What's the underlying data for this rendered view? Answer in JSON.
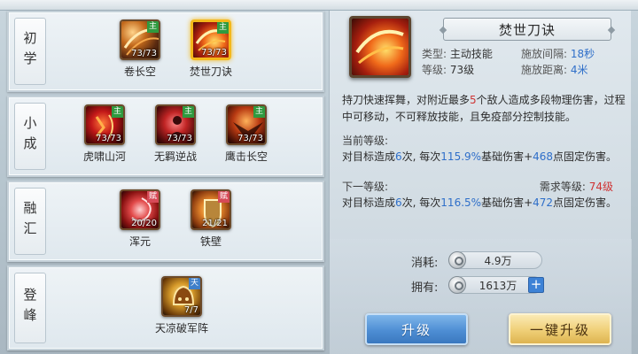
{
  "tiers": [
    {
      "label": "初学",
      "skills": [
        {
          "name": "卷长空",
          "count": "73/73",
          "badge": "主",
          "badge_type": "main",
          "icon": "wind-slash-icon",
          "selected": false
        },
        {
          "name": "焚世刀诀",
          "count": "73/73",
          "badge": "主",
          "badge_type": "main",
          "icon": "flame-blade-icon",
          "selected": true
        }
      ]
    },
    {
      "label": "小成",
      "skills": [
        {
          "name": "虎啸山河",
          "count": "73/73",
          "badge": "主",
          "badge_type": "main",
          "icon": "tiger-roar-icon"
        },
        {
          "name": "无羁逆战",
          "count": "73/73",
          "badge": "主",
          "badge_type": "main",
          "icon": "warrior-stance-icon"
        },
        {
          "name": "鹰击长空",
          "count": "73/73",
          "badge": "主",
          "badge_type": "main",
          "icon": "eagle-strike-icon"
        }
      ]
    },
    {
      "label": "融汇",
      "skills": [
        {
          "name": "浑元",
          "count": "20/20",
          "badge": "赋",
          "badge_type": "fu",
          "icon": "swirl-energy-icon"
        },
        {
          "name": "铁壁",
          "count": "21/21",
          "badge": "赋",
          "badge_type": "fu",
          "icon": "iron-shield-icon"
        }
      ]
    },
    {
      "label": "登峰",
      "skills": [
        {
          "name": "天凉破军阵",
          "count": "7/7",
          "badge": "天",
          "badge_type": "tian",
          "icon": "golden-helm-icon"
        }
      ]
    }
  ],
  "detail": {
    "title": "焚世刀诀",
    "type_label": "类型:",
    "type_value": "主动技能",
    "interval_label": "施放间隔:",
    "interval_value": "18秒",
    "level_label": "等级:",
    "level_value": "73级",
    "distance_label": "施放距离:",
    "distance_value": "4米",
    "desc_part1": "持刀快速挥舞，对附近最多",
    "desc_num": "5",
    "desc_part2": "个敌人造成多段物理伤害，过程中可移动，不可释放技能，且免疫部分控制技能。",
    "current_title": "当前等级:",
    "current_prefix": "对目标造成",
    "current_times": "6",
    "current_mid": "次, 每次",
    "current_pct": "115.9%",
    "current_mid2": "基础伤害+",
    "current_flat": "468",
    "current_suffix": "点固定伤害。",
    "next_title": "下一等级:",
    "req_label": "需求等级:",
    "req_value": "74级",
    "next_prefix": "对目标造成",
    "next_times": "6",
    "next_mid": "次, 每次",
    "next_pct": "116.5%",
    "next_mid2": "基础伤害+",
    "next_flat": "472",
    "next_suffix": "点固定伤害。"
  },
  "cost": {
    "consume_label": "消耗:",
    "consume_value": "4.9万",
    "own_label": "拥有:",
    "own_value": "1613万",
    "plus": "+"
  },
  "buttons": {
    "upgrade": "升级",
    "upgrade_all": "一键升级"
  },
  "colors": {
    "highlight_blue": "#2f6fc9",
    "highlight_red": "#cf3434",
    "selected_border": "#f4b81a"
  }
}
